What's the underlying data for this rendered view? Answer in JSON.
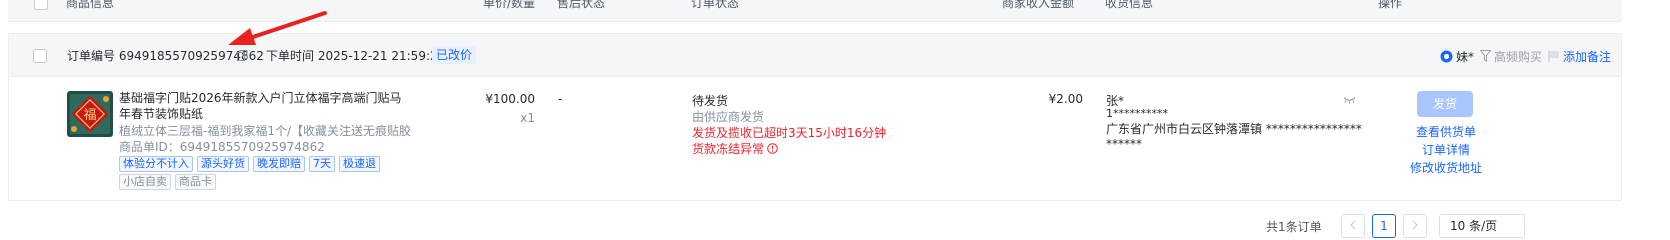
{
  "header": {
    "col_product": "商品信息",
    "col_price_qty": "单价/数量",
    "col_after_sale": "售后状态",
    "col_order_status": "订单状态",
    "col_income": "商家收入金额",
    "col_receiver": "收货信息",
    "col_action": "操作"
  },
  "order": {
    "order_no_label": "订单编号 6949185570925974862",
    "order_time_label": "下单时间 2025-12-21 21:59:27",
    "price_changed_tag": "已改价",
    "buyer_name": "妹*",
    "high_freq_label": "高频购买",
    "add_note_label": "添加备注",
    "product": {
      "title": "基础福字门贴2026年新款入户门立体福字高端门贴马年春节装饰贴纸",
      "spec": "植绒立体三层福-福到我家福1个/【收藏关注送无痕贴胶...",
      "product_id": "商品单ID：6949185570925974862",
      "tags": [
        "体验分不计入",
        "源头好货",
        "晚发即赔",
        "7天",
        "极速退"
      ],
      "tags2": [
        "小店自卖",
        "商品卡"
      ],
      "thumb_char": "福"
    },
    "price": "¥100.00",
    "quantity": "x1",
    "after_sale": "-",
    "status": {
      "main": "待发货",
      "sub": "由供应商发货",
      "warning": "发货及揽收已超时3天15小时16分钟",
      "frozen": "货款冻结异常"
    },
    "income": "¥2.00",
    "receiver": {
      "name": "张*",
      "phone": "1**********",
      "address": "广东省广州市白云区钟落潭镇 **********************"
    },
    "actions": {
      "ship": "发货",
      "view_supply": "查看供货单",
      "order_detail": "订单详情",
      "modify_address": "修改收货地址"
    }
  },
  "pagination": {
    "total": "共1条订单",
    "current_page": "1",
    "page_size": "10 条/页"
  },
  "colors": {
    "accent": "#1966ff",
    "danger": "#f5222d",
    "annotation_arrow": "#e8231f"
  }
}
